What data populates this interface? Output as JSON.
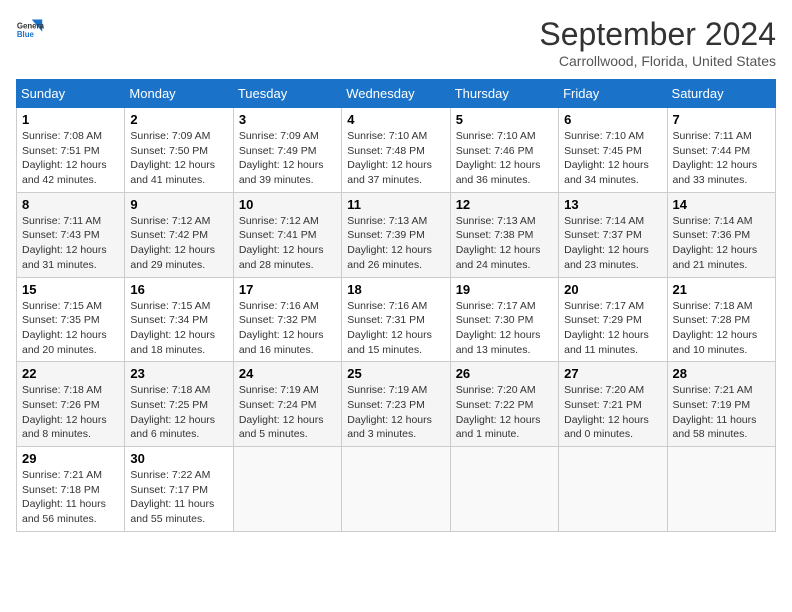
{
  "logo": {
    "line1": "General",
    "line2": "Blue"
  },
  "title": "September 2024",
  "subtitle": "Carrollwood, Florida, United States",
  "days_of_week": [
    "Sunday",
    "Monday",
    "Tuesday",
    "Wednesday",
    "Thursday",
    "Friday",
    "Saturday"
  ],
  "weeks": [
    [
      {
        "day": "1",
        "sunrise": "7:08 AM",
        "sunset": "7:51 PM",
        "daylight": "12 hours and 42 minutes."
      },
      {
        "day": "2",
        "sunrise": "7:09 AM",
        "sunset": "7:50 PM",
        "daylight": "12 hours and 41 minutes."
      },
      {
        "day": "3",
        "sunrise": "7:09 AM",
        "sunset": "7:49 PM",
        "daylight": "12 hours and 39 minutes."
      },
      {
        "day": "4",
        "sunrise": "7:10 AM",
        "sunset": "7:48 PM",
        "daylight": "12 hours and 37 minutes."
      },
      {
        "day": "5",
        "sunrise": "7:10 AM",
        "sunset": "7:46 PM",
        "daylight": "12 hours and 36 minutes."
      },
      {
        "day": "6",
        "sunrise": "7:10 AM",
        "sunset": "7:45 PM",
        "daylight": "12 hours and 34 minutes."
      },
      {
        "day": "7",
        "sunrise": "7:11 AM",
        "sunset": "7:44 PM",
        "daylight": "12 hours and 33 minutes."
      }
    ],
    [
      {
        "day": "8",
        "sunrise": "7:11 AM",
        "sunset": "7:43 PM",
        "daylight": "12 hours and 31 minutes."
      },
      {
        "day": "9",
        "sunrise": "7:12 AM",
        "sunset": "7:42 PM",
        "daylight": "12 hours and 29 minutes."
      },
      {
        "day": "10",
        "sunrise": "7:12 AM",
        "sunset": "7:41 PM",
        "daylight": "12 hours and 28 minutes."
      },
      {
        "day": "11",
        "sunrise": "7:13 AM",
        "sunset": "7:39 PM",
        "daylight": "12 hours and 26 minutes."
      },
      {
        "day": "12",
        "sunrise": "7:13 AM",
        "sunset": "7:38 PM",
        "daylight": "12 hours and 24 minutes."
      },
      {
        "day": "13",
        "sunrise": "7:14 AM",
        "sunset": "7:37 PM",
        "daylight": "12 hours and 23 minutes."
      },
      {
        "day": "14",
        "sunrise": "7:14 AM",
        "sunset": "7:36 PM",
        "daylight": "12 hours and 21 minutes."
      }
    ],
    [
      {
        "day": "15",
        "sunrise": "7:15 AM",
        "sunset": "7:35 PM",
        "daylight": "12 hours and 20 minutes."
      },
      {
        "day": "16",
        "sunrise": "7:15 AM",
        "sunset": "7:34 PM",
        "daylight": "12 hours and 18 minutes."
      },
      {
        "day": "17",
        "sunrise": "7:16 AM",
        "sunset": "7:32 PM",
        "daylight": "12 hours and 16 minutes."
      },
      {
        "day": "18",
        "sunrise": "7:16 AM",
        "sunset": "7:31 PM",
        "daylight": "12 hours and 15 minutes."
      },
      {
        "day": "19",
        "sunrise": "7:17 AM",
        "sunset": "7:30 PM",
        "daylight": "12 hours and 13 minutes."
      },
      {
        "day": "20",
        "sunrise": "7:17 AM",
        "sunset": "7:29 PM",
        "daylight": "12 hours and 11 minutes."
      },
      {
        "day": "21",
        "sunrise": "7:18 AM",
        "sunset": "7:28 PM",
        "daylight": "12 hours and 10 minutes."
      }
    ],
    [
      {
        "day": "22",
        "sunrise": "7:18 AM",
        "sunset": "7:26 PM",
        "daylight": "12 hours and 8 minutes."
      },
      {
        "day": "23",
        "sunrise": "7:18 AM",
        "sunset": "7:25 PM",
        "daylight": "12 hours and 6 minutes."
      },
      {
        "day": "24",
        "sunrise": "7:19 AM",
        "sunset": "7:24 PM",
        "daylight": "12 hours and 5 minutes."
      },
      {
        "day": "25",
        "sunrise": "7:19 AM",
        "sunset": "7:23 PM",
        "daylight": "12 hours and 3 minutes."
      },
      {
        "day": "26",
        "sunrise": "7:20 AM",
        "sunset": "7:22 PM",
        "daylight": "12 hours and 1 minute."
      },
      {
        "day": "27",
        "sunrise": "7:20 AM",
        "sunset": "7:21 PM",
        "daylight": "12 hours and 0 minutes."
      },
      {
        "day": "28",
        "sunrise": "7:21 AM",
        "sunset": "7:19 PM",
        "daylight": "11 hours and 58 minutes."
      }
    ],
    [
      {
        "day": "29",
        "sunrise": "7:21 AM",
        "sunset": "7:18 PM",
        "daylight": "11 hours and 56 minutes."
      },
      {
        "day": "30",
        "sunrise": "7:22 AM",
        "sunset": "7:17 PM",
        "daylight": "11 hours and 55 minutes."
      },
      null,
      null,
      null,
      null,
      null
    ]
  ],
  "labels": {
    "sunrise": "Sunrise:",
    "sunset": "Sunset:",
    "daylight": "Daylight:"
  }
}
